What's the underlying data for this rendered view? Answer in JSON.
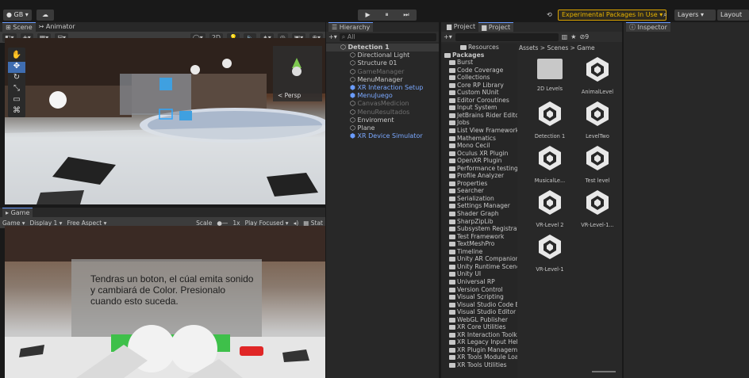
{
  "top": {
    "account": "GB ▾",
    "experimental": "Experimental Packages In Use ▾",
    "layers": "Layers",
    "layout": "Layout",
    "play_icons": [
      "▶",
      "⏸",
      "⏭"
    ]
  },
  "scene": {
    "tabs": [
      "Scene",
      "Animator"
    ],
    "persp": "< Persp",
    "toolbar": [
      "2D"
    ],
    "overlay_text": "Tendras..."
  },
  "game": {
    "tab": "Game",
    "toolbar": [
      "Game",
      "Display 1",
      "Free Aspect",
      "Scale",
      "1x",
      "Play Focused",
      "Stat"
    ],
    "text": "Tendras un boton, el cúal emita sonido y cambiará de Color. Presionalo cuando esto suceda."
  },
  "hierarchy": {
    "tab": "Hierarchy",
    "search": "All",
    "items": [
      {
        "label": "Detection 1",
        "depth": 0,
        "bold": true
      },
      {
        "label": "Directional Light",
        "depth": 1
      },
      {
        "label": "Structure 01",
        "depth": 1
      },
      {
        "label": "GameManager",
        "depth": 1,
        "dim": true
      },
      {
        "label": "MenuManager",
        "depth": 1
      },
      {
        "label": "XR Interaction Setup",
        "depth": 1,
        "blue": true
      },
      {
        "label": "MenuJuego",
        "depth": 1,
        "blue": true
      },
      {
        "label": "CanvasMedicion",
        "depth": 1,
        "dim": true
      },
      {
        "label": "MenuResultados",
        "depth": 1,
        "dim": true
      },
      {
        "label": "Enviroment",
        "depth": 1
      },
      {
        "label": "Plane",
        "depth": 1
      },
      {
        "label": "XR Device Simulator",
        "depth": 1,
        "blue": true
      }
    ]
  },
  "project": {
    "tabs": [
      "Project",
      "Project"
    ],
    "breadcrumb": "Assets > Scenes > Game",
    "count": "9",
    "tree": [
      "Resources",
      "Packages",
      "Burst",
      "Code Coverage",
      "Collections",
      "Core RP Library",
      "Custom NUnit",
      "Editor Coroutines",
      "Input System",
      "JetBrains Rider Edito",
      "Jobs",
      "List View Framework",
      "Mathematics",
      "Mono Cecil",
      "Oculus XR Plugin",
      "OpenXR Plugin",
      "Performance testing",
      "Profile Analyzer",
      "Properties",
      "Searcher",
      "Serialization",
      "Settings Manager",
      "Shader Graph",
      "SharpZipLib",
      "Subsystem Registrat",
      "Test Framework",
      "TextMeshPro",
      "Timeline",
      "Unity AR Companion",
      "Unity Runtime Scene",
      "Unity UI",
      "Universal RP",
      "Version Control",
      "Visual Scripting",
      "Visual Studio Code E",
      "Visual Studio Editor",
      "WebGL Publisher",
      "XR Core Utilities",
      "XR Interaction Toolki",
      "XR Legacy Input Help",
      "XR Plugin Manageme",
      "XR Tools Module Loa",
      "XR Tools Utilities"
    ],
    "assets": [
      "2D Levels",
      "AnimalLevel",
      "Detection 1",
      "LevelTwo",
      "MusicalLe...",
      "Test level",
      "VR-Level 2",
      "VR-Level-1...",
      "VR-Level-1"
    ]
  },
  "inspector": {
    "tab": "Inspector"
  },
  "colors": {
    "accent": "#6a9cff",
    "warning": "#e8b400",
    "panel": "#282828",
    "bg": "#191919"
  }
}
